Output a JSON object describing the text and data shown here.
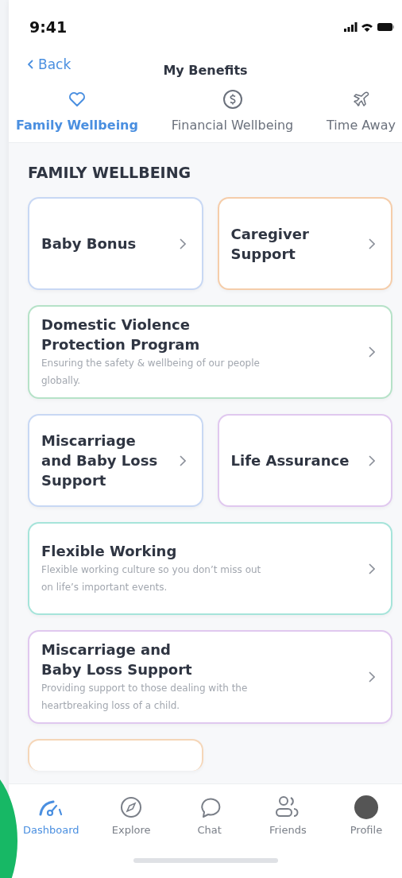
{
  "status_bar": {
    "time": "9:41"
  },
  "header": {
    "back": "Back",
    "title": "My Benefits"
  },
  "tabs": [
    {
      "label": "Family Wellbeing",
      "selected": true
    },
    {
      "label": "Financial Wellbeing",
      "selected": false
    },
    {
      "label": "Time Away",
      "selected": false
    }
  ],
  "section_title": "FAMILY WELLBEING",
  "cards": [
    {
      "kind": "half",
      "title": "Baby Bonus",
      "color": "#c8d8f4"
    },
    {
      "kind": "half",
      "title": "Caregiver Support",
      "color": "#f5cdaa"
    },
    {
      "kind": "full",
      "title": "Domestic Violence Protection Program",
      "description": "Ensuring the safety & wellbeing of our people globally.",
      "color": "#b6e2c8"
    },
    {
      "kind": "half",
      "title": "Miscarriage and Baby Loss Support",
      "color": "#c8d8f4"
    },
    {
      "kind": "half",
      "title": "Life Assurance",
      "color": "#e0c8ef"
    },
    {
      "kind": "full",
      "title": "Flexible Working",
      "description": "Flexible working culture so you don’t miss out on life’s important events.",
      "color": "#a6e4da"
    },
    {
      "kind": "full",
      "title": "Miscarriage and Baby Loss Support",
      "description": "Providing support to those dealing with the heartbreaking loss of a child.",
      "color": "#e0c8ef"
    },
    {
      "kind": "peek",
      "color": "#f5d6b8"
    }
  ],
  "nav": [
    {
      "label": "Dashboard",
      "selected": true
    },
    {
      "label": "Explore",
      "selected": false
    },
    {
      "label": "Chat",
      "selected": false
    },
    {
      "label": "Friends",
      "selected": false
    },
    {
      "label": "Profile",
      "selected": false
    }
  ]
}
